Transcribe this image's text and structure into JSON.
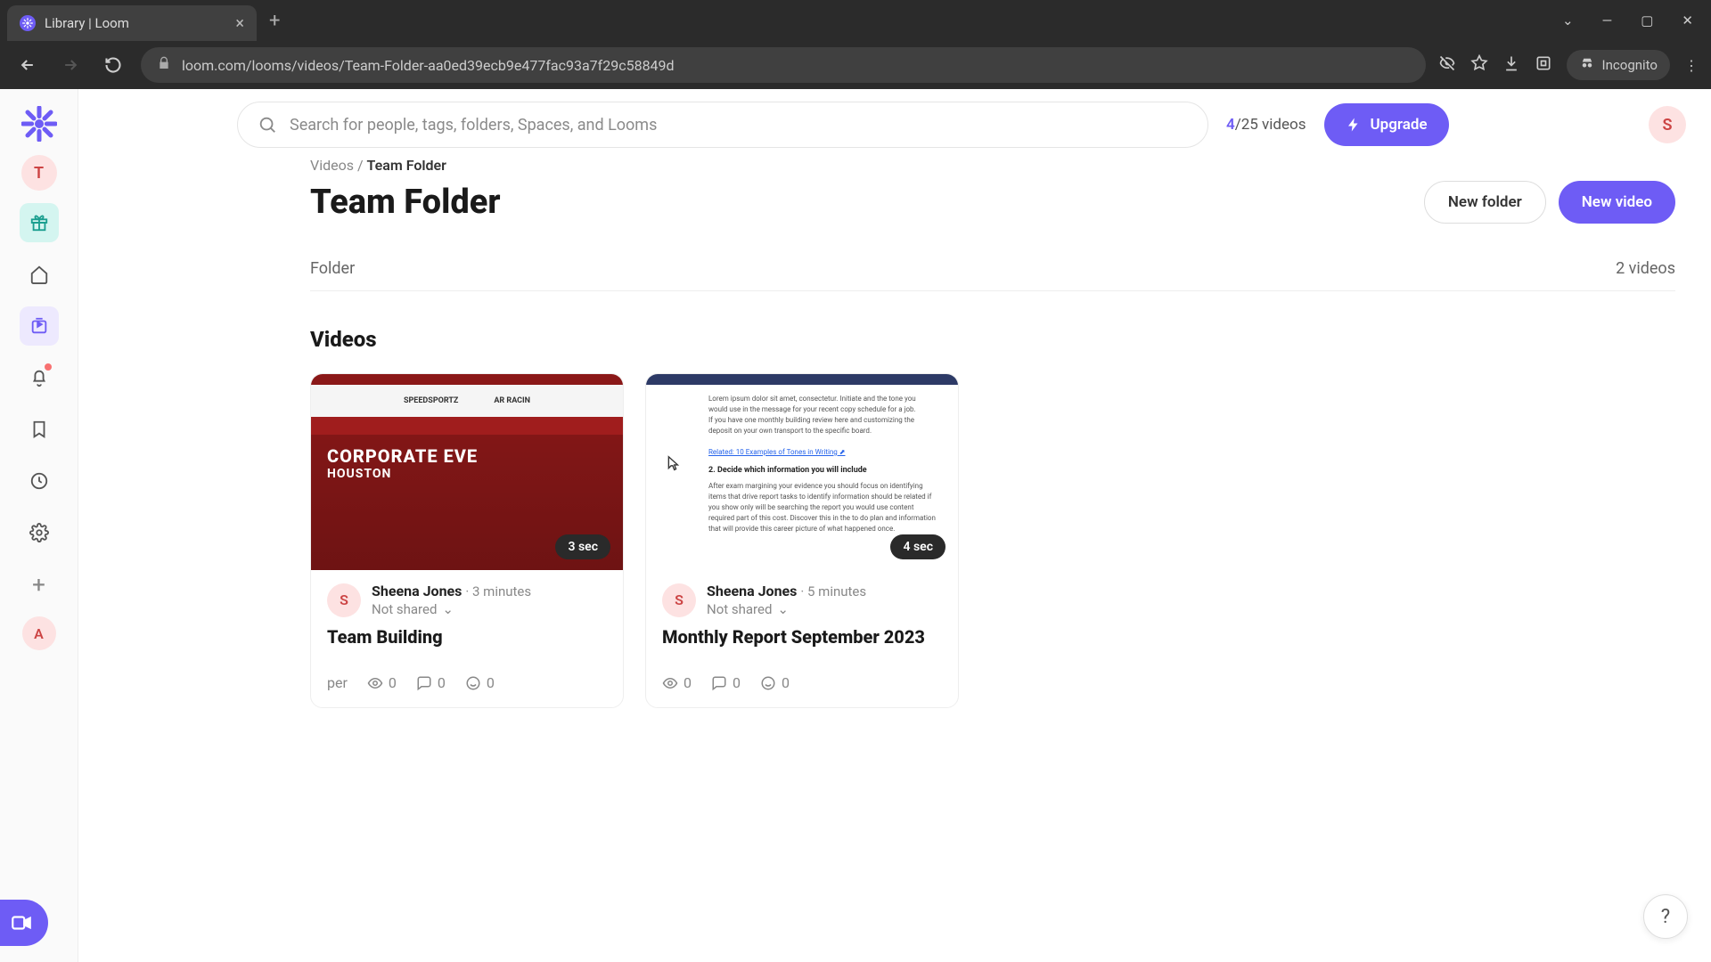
{
  "browser": {
    "tab_title": "Library | Loom",
    "url": "loom.com/looms/videos/Team-Folder-aa0ed39ecb9e477fac93a7f29c58849d",
    "incognito": "Incognito"
  },
  "topbar": {
    "search_placeholder": "Search for people, tags, folders, Spaces, and Looms",
    "video_count_used": "4",
    "video_count_sep": "/25 videos",
    "upgrade": "Upgrade",
    "user_initial": "S"
  },
  "leftrail": {
    "workspace_initial": "T",
    "bottom_initial": "A"
  },
  "breadcrumb": {
    "parent": "Videos",
    "sep": " / ",
    "current": "Team Folder"
  },
  "page": {
    "title": "Team Folder",
    "new_folder": "New folder",
    "new_video": "New video",
    "folder_label": "Folder",
    "folder_count": "2 videos",
    "videos_heading": "Videos"
  },
  "cards": [
    {
      "duration": "3 sec",
      "author_initial": "S",
      "author_name": "Sheena Jones",
      "time_ago": "3 minutes",
      "share": "Not shared",
      "title": "Team Building",
      "views": "0",
      "comments": "0",
      "reactions": "0",
      "thumb_line1": "CORPORATE EVE",
      "thumb_line2": "HOUSTON"
    },
    {
      "duration": "4 sec",
      "author_initial": "S",
      "author_name": "Sheena Jones",
      "time_ago": "5 minutes",
      "share": "Not shared",
      "title": "Monthly Report September 2023",
      "views": "0",
      "comments": "0",
      "reactions": "0",
      "thumb_heading": "2. Decide which information you will include",
      "thumb_link": "Related: 10 Examples of Tones in Writing ⬈"
    }
  ],
  "help": "?"
}
